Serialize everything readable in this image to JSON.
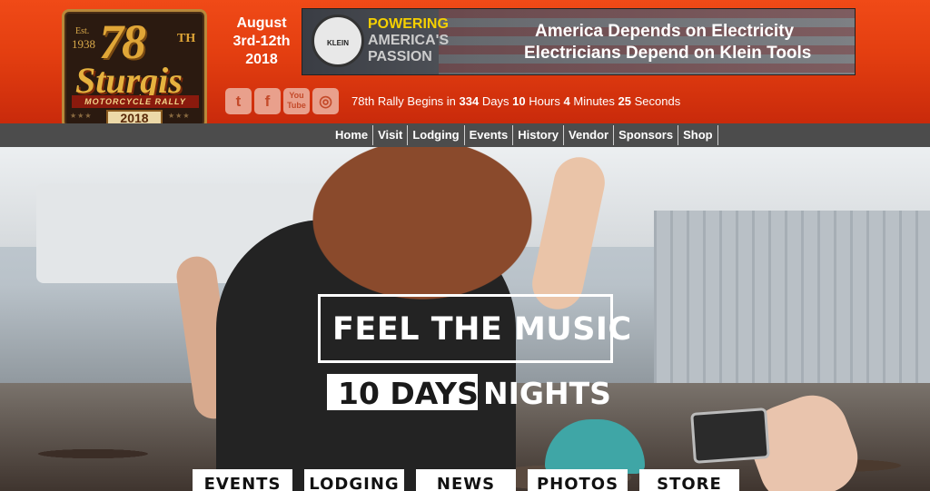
{
  "logo": {
    "est_label": "Est.",
    "est_year": "1938",
    "edition": "78",
    "edition_suffix": "TH",
    "name": "Sturgis",
    "subtitle": "MOTORCYCLE RALLY",
    "year": "2018",
    "stars": "★★★"
  },
  "dates": {
    "month": "August",
    "range": "3rd-12th",
    "year": "2018"
  },
  "banner": {
    "brand": "KLEIN TOOLS",
    "tag_1": "POWERING",
    "tag_2": "AMERICA'S",
    "tag_3": "PASSION",
    "line_1": "America Depends on Electricity",
    "line_2": "Electricians Depend on Klein Tools"
  },
  "social": {
    "twitter": "t",
    "facebook": "f",
    "youtube_1": "You",
    "youtube_2": "Tube",
    "instagram": "◎"
  },
  "countdown": {
    "prefix": "78th Rally Begins in",
    "days": "334",
    "days_label": "Days",
    "hours": "10",
    "hours_label": "Hours",
    "minutes": "4",
    "minutes_label": "Minutes",
    "seconds": "25",
    "seconds_label": "Seconds"
  },
  "nav": {
    "items": [
      "Home",
      "Visit",
      "Lodging",
      "Events",
      "History",
      "Vendor",
      "Sponsors",
      "Shop"
    ]
  },
  "hero": {
    "title": "FEEL THE MUSIC",
    "sub_1": "10 DAYS",
    "sub_2": "NIGHTS"
  },
  "cta": {
    "items": [
      "EVENTS",
      "LODGING",
      "NEWS",
      "PHOTOS",
      "STORE"
    ]
  }
}
